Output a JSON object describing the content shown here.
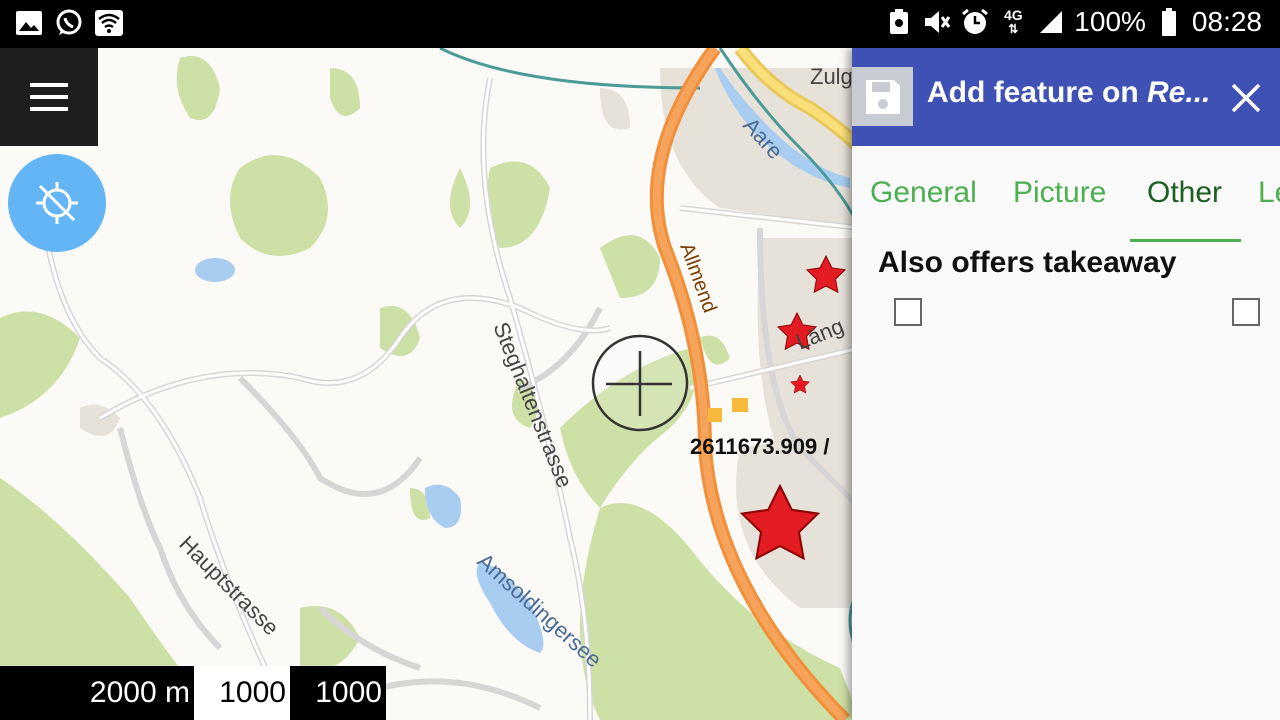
{
  "status_bar": {
    "battery": "100%",
    "time": "08:28",
    "network": "4G",
    "left_icons": [
      "image-icon",
      "whatsapp-icon",
      "wifi-icon"
    ],
    "right_icons": [
      "nfc-icon",
      "mute-icon",
      "alarm-icon",
      "signal-icon",
      "battery-icon"
    ]
  },
  "map": {
    "labels": {
      "road_1": "Steghaltenstrasse",
      "road_2": "Hauptstrasse",
      "road_3": "Allmend",
      "road_4": "Läng",
      "road_5": "Zulg",
      "water_1": "Amsoldingersee",
      "water_2": "Aare"
    },
    "coordinate": "2611673.909 /",
    "scale": [
      "2000 m",
      "1000",
      "1000"
    ],
    "colors": {
      "forest": "#cde0a6",
      "urban": "#e6e2da",
      "water": "#a8cdf0",
      "highway": "#f28f3b",
      "railway": "#4a9a97",
      "star": "#e31b23"
    }
  },
  "menu_button": {
    "icon": "hamburger-icon"
  },
  "gps_button": {
    "icon": "gps-off-icon"
  },
  "panel": {
    "title_prefix": "Add feature on ",
    "title_emph": "Re...",
    "header_color": "#3f51b5",
    "tabs": [
      {
        "label": "General",
        "active": false
      },
      {
        "label": "Picture",
        "active": false
      },
      {
        "label": "Other",
        "active": true
      },
      {
        "label": "Le",
        "active": false
      }
    ],
    "field_label": "Also offers takeaway"
  }
}
